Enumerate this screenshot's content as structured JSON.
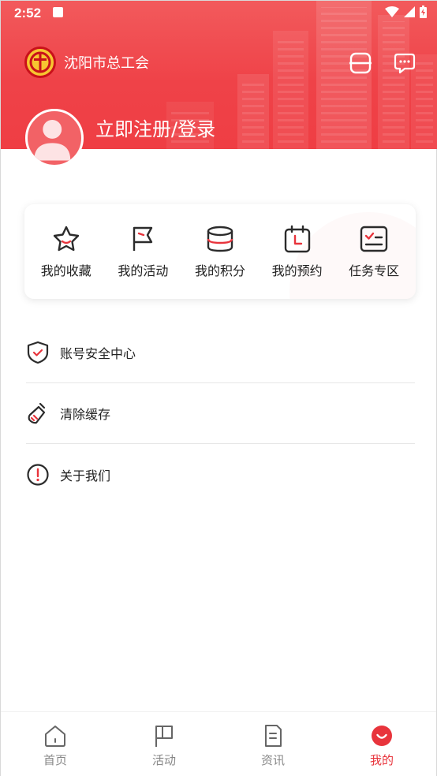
{
  "status_bar": {
    "time": "2:52"
  },
  "header": {
    "brand_name": "沈阳市总工会",
    "login_text": "立即注册/登录",
    "scan_icon": "scan-icon",
    "message_icon": "chat-icon"
  },
  "quick_actions": [
    {
      "label": "我的收藏",
      "icon": "star-icon"
    },
    {
      "label": "我的活动",
      "icon": "flag-icon"
    },
    {
      "label": "我的积分",
      "icon": "coins-icon"
    },
    {
      "label": "我的预约",
      "icon": "calendar-icon"
    },
    {
      "label": "任务专区",
      "icon": "task-board-icon"
    }
  ],
  "menu": [
    {
      "label": "账号安全中心",
      "icon": "shield-check-icon"
    },
    {
      "label": "清除缓存",
      "icon": "broom-icon"
    },
    {
      "label": "关于我们",
      "icon": "info-alert-icon"
    }
  ],
  "tabbar": [
    {
      "label": "首页",
      "icon": "home-icon",
      "active": false
    },
    {
      "label": "活动",
      "icon": "flag-icon",
      "active": false
    },
    {
      "label": "资讯",
      "icon": "document-icon",
      "active": false
    },
    {
      "label": "我的",
      "icon": "smile-icon",
      "active": true
    }
  ],
  "colors": {
    "brand_red": "#ef4248",
    "accent": "#e8343c"
  }
}
